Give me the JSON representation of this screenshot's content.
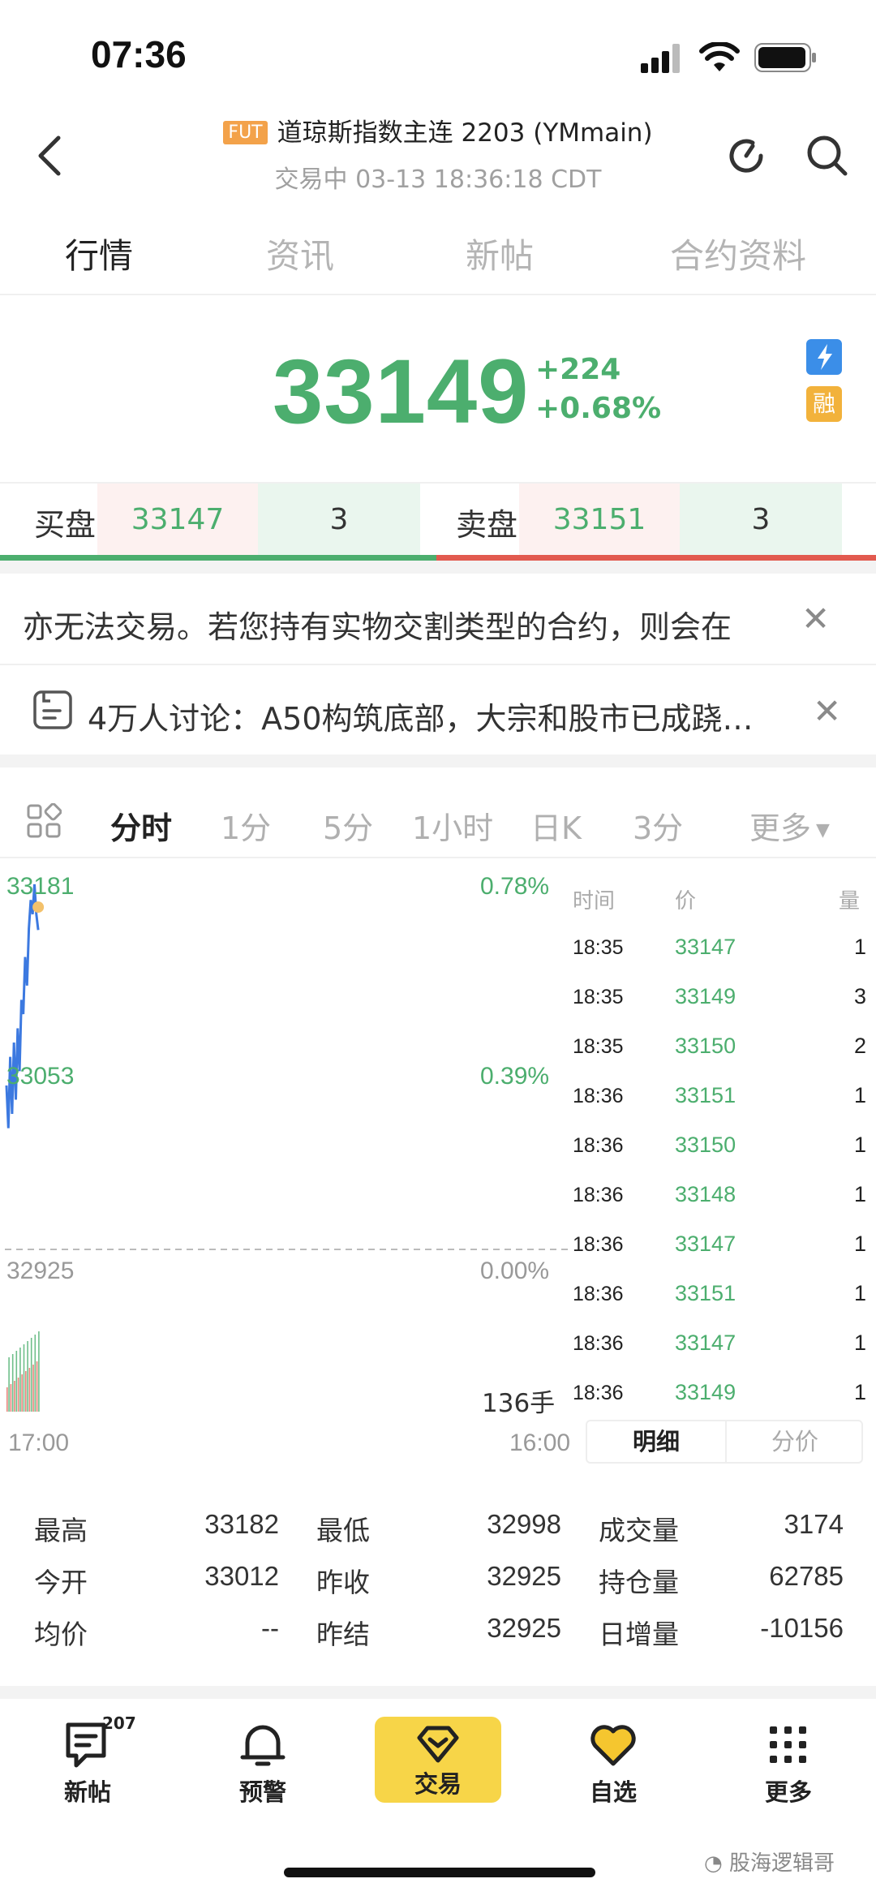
{
  "status_bar": {
    "time": "07:36"
  },
  "header": {
    "badge": "FUT",
    "title": "道琼斯指数主连 2203 (YMmain)",
    "subtitle": "交易中 03-13 18:36:18 CDT"
  },
  "tabs": [
    "行情",
    "资讯",
    "新帖",
    "合约资料"
  ],
  "quote": {
    "price": "33149",
    "change": "+224",
    "change_pct": "+0.68%",
    "badge_rong": "融"
  },
  "bid": {
    "label": "买盘",
    "price": "33147",
    "qty": "3"
  },
  "ask": {
    "label": "卖盘",
    "price": "33151",
    "qty": "3"
  },
  "notices": [
    {
      "text": "亦无法交易。若您持有实物交割类型的合约，则会在"
    },
    {
      "text": "4万人讨论：A50构筑底部，大宗和股市已成跷…"
    }
  ],
  "chart_tabs": [
    "分时",
    "1分",
    "5分",
    "1小时",
    "日K",
    "3分",
    "更多"
  ],
  "chart_data": {
    "type": "line",
    "y_labels_left": [
      "33181",
      "33053",
      "32925"
    ],
    "y_labels_right": [
      "0.78%",
      "0.39%",
      "0.00%"
    ],
    "x_labels": [
      "17:00",
      "16:00"
    ],
    "volume_label": "136手",
    "ylim": [
      32669,
      33181
    ],
    "series": [
      {
        "values": [
          33040,
          33010,
          33060,
          33020,
          33070,
          33030,
          33080,
          33050,
          33100,
          33090,
          33130,
          33110,
          33150,
          33170,
          33160,
          33181,
          33160,
          33149
        ]
      }
    ]
  },
  "ticks": {
    "headers": [
      "时间",
      "价",
      "量"
    ],
    "rows": [
      {
        "time": "18:35",
        "price": "33147",
        "vol": "1"
      },
      {
        "time": "18:35",
        "price": "33149",
        "vol": "3"
      },
      {
        "time": "18:35",
        "price": "33150",
        "vol": "2"
      },
      {
        "time": "18:36",
        "price": "33151",
        "vol": "1"
      },
      {
        "time": "18:36",
        "price": "33150",
        "vol": "1"
      },
      {
        "time": "18:36",
        "price": "33148",
        "vol": "1"
      },
      {
        "time": "18:36",
        "price": "33147",
        "vol": "1"
      },
      {
        "time": "18:36",
        "price": "33151",
        "vol": "1"
      },
      {
        "time": "18:36",
        "price": "33147",
        "vol": "1"
      },
      {
        "time": "18:36",
        "price": "33149",
        "vol": "1"
      }
    ],
    "tabs": [
      "明细",
      "分价"
    ]
  },
  "stats": [
    [
      {
        "label": "最高",
        "value": "33182"
      },
      {
        "label": "最低",
        "value": "32998"
      },
      {
        "label": "成交量",
        "value": "3174"
      }
    ],
    [
      {
        "label": "今开",
        "value": "33012"
      },
      {
        "label": "昨收",
        "value": "32925"
      },
      {
        "label": "持仓量",
        "value": "62785"
      }
    ],
    [
      {
        "label": "均价",
        "value": "--"
      },
      {
        "label": "昨结",
        "value": "32925"
      },
      {
        "label": "日增量",
        "value": "-10156"
      }
    ]
  ],
  "bottom_nav": [
    {
      "label": "新帖",
      "badge": "207"
    },
    {
      "label": "预警"
    },
    {
      "label": "交易"
    },
    {
      "label": "自选"
    },
    {
      "label": "更多"
    }
  ],
  "watermark": "股海逻辑哥"
}
